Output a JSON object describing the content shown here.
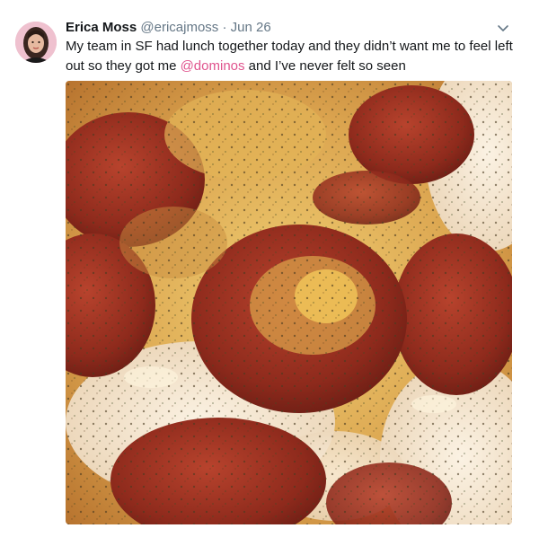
{
  "tweet": {
    "author_name": "Erica Moss",
    "handle": "@ericajmoss",
    "separator": "·",
    "date": "Jun 26",
    "text_before": "My team in SF had lunch together today and they didn’t want me to feel left out so they got me ",
    "mention": "@dominos",
    "text_after": " and I’ve never felt so seen"
  },
  "icons": {
    "more": "chevron-down-icon"
  },
  "colors": {
    "mention": "#e0538d",
    "secondary_text": "#657786"
  }
}
